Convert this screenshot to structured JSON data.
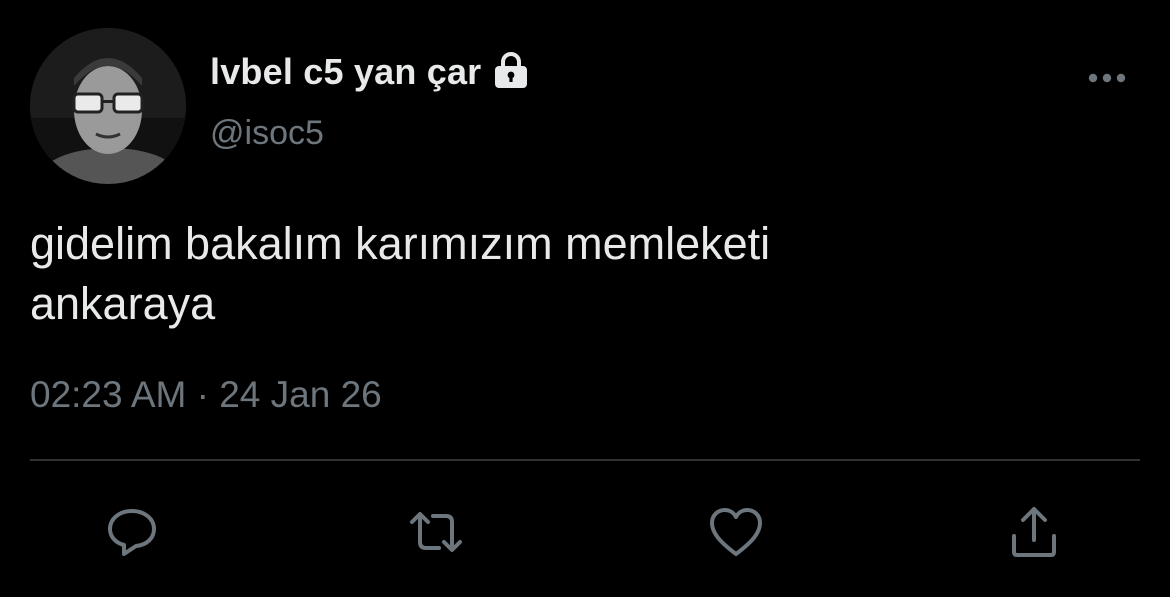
{
  "tweet": {
    "display_name": "lvbel c5 yan çar",
    "username": "@isoc5",
    "text": "gidelim bakalım karımızım memleketi\nankaraya",
    "time": "02:23 AM",
    "separator": " · ",
    "date": "24 Jan 26",
    "protected_icon": "lock-icon"
  },
  "actions": [
    {
      "name": "reply",
      "icon": "speech-bubble-icon"
    },
    {
      "name": "retweet",
      "icon": "retweet-arrows-icon"
    },
    {
      "name": "like",
      "icon": "heart-icon"
    },
    {
      "name": "share",
      "icon": "share-upload-icon"
    }
  ],
  "colors": {
    "background": "#000000",
    "primary_text": "#e7e9ea",
    "secondary_text": "#6e767d",
    "divider": "#2f3336"
  }
}
